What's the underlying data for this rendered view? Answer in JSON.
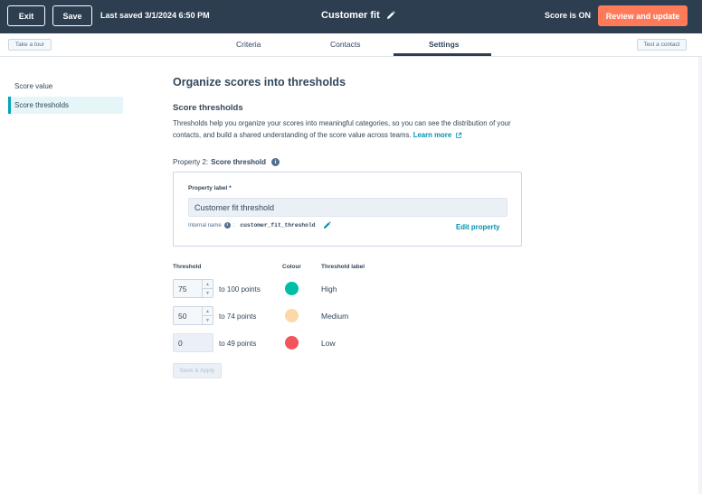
{
  "topbar": {
    "exit_label": "Exit",
    "save_label": "Save",
    "last_saved": "Last saved 3/1/2024 6:50 PM",
    "title": "Customer fit",
    "score_status": "Score is ON",
    "review_label": "Review and update",
    "review_color": "#ff7a59"
  },
  "tabbar": {
    "tour_label": "Take a tour",
    "test_label": "Test a contact",
    "tabs": [
      {
        "label": "Criteria"
      },
      {
        "label": "Contacts"
      },
      {
        "label": "Settings",
        "active": true
      }
    ]
  },
  "sidebar": {
    "items": [
      {
        "label": "Score value"
      },
      {
        "label": "Score thresholds",
        "active": true
      }
    ]
  },
  "main": {
    "heading": "Organize scores into thresholds",
    "subheading": "Score thresholds",
    "description": "Thresholds help you organize your scores into meaningful categories, so you can see the distribution of your contacts, and build a shared understanding of the score value across teams.",
    "learn_more": "Learn more",
    "property_prefix": "Property 2:",
    "property_name": "Score threshold",
    "card": {
      "label": "Property label *",
      "value": "Customer fit threshold",
      "internal_name_label": "Internal name",
      "internal_name_sep": ":",
      "internal_name_value": "customer_fit_threshold",
      "edit_label": "Edit property"
    },
    "table": {
      "headers": {
        "threshold": "Threshold",
        "colour": "Colour",
        "label": "Threshold label"
      },
      "rows": [
        {
          "min": "75",
          "range": "to  100 points",
          "color": "#00bda5",
          "label": "High"
        },
        {
          "min": "50",
          "range": "to  74 points",
          "color": "#fcd8a8",
          "label": "Medium"
        },
        {
          "min": "0",
          "range": "to 49 points",
          "color": "#f2545b",
          "label": "Low"
        }
      ]
    },
    "save_apply_label": "Save & Apply"
  }
}
